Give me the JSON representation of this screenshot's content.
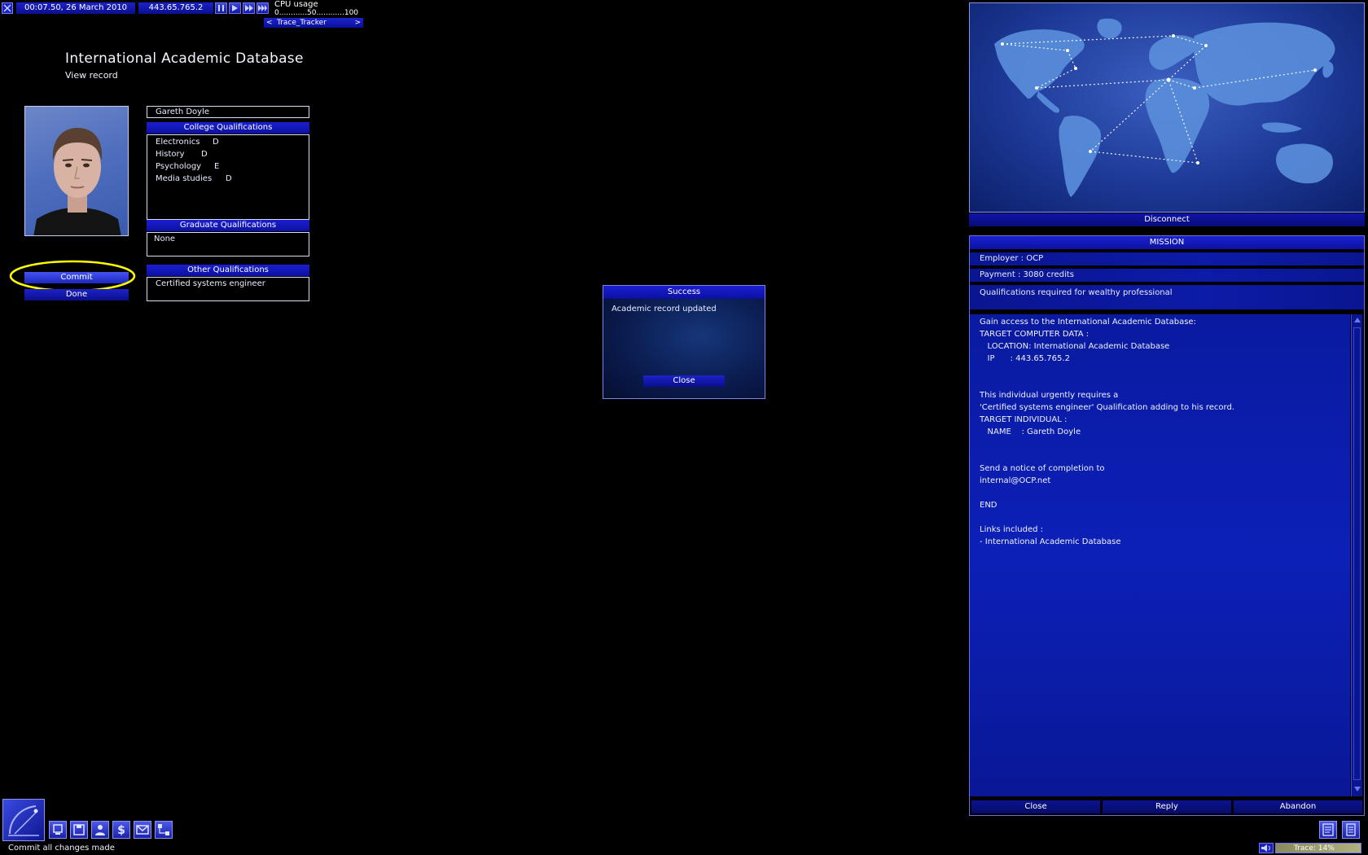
{
  "topbar": {
    "time": "00:07.50, 26 March 2010",
    "ip": "443.65.765.2",
    "cpu_label": "CPU usage",
    "cpu_scale": "0............50............100",
    "trace_tracker": "Trace_Tracker",
    "trace_prev": "<",
    "trace_next": ">"
  },
  "page": {
    "title": "International Academic Database",
    "subtitle": "View record"
  },
  "record": {
    "name": "Gareth Doyle",
    "college_header": "College Qualifications",
    "college": [
      {
        "subject": "Electronics",
        "grade": "D"
      },
      {
        "subject": "History",
        "grade": "D"
      },
      {
        "subject": "Psychology",
        "grade": "E"
      },
      {
        "subject": "Media studies",
        "grade": "D"
      }
    ],
    "graduate_header": "Graduate Qualifications",
    "graduate": "None",
    "other_header": "Other Qualifications",
    "other": "Certified systems engineer",
    "commit_label": "Commit",
    "done_label": "Done"
  },
  "dialog": {
    "title": "Success",
    "message": "Academic record updated",
    "close_label": "Close"
  },
  "map": {
    "disconnect_label": "Disconnect"
  },
  "mission": {
    "header": "MISSION",
    "employer": "Employer : OCP",
    "payment": "Payment : 3080 credits",
    "summary": "Qualifications required for wealthy professional",
    "body": [
      "Gain access to the International Academic Database:",
      "TARGET COMPUTER DATA :",
      "   LOCATION: International Academic Database",
      "   IP      : 443.65.765.2",
      "",
      "",
      "This individual urgently requires a",
      "'Certified systems engineer' Qualification adding to his record.",
      "TARGET INDIVIDUAL :",
      "   NAME    : Gareth Doyle",
      "",
      "",
      "Send a notice of completion to",
      "internal@OCP.net",
      "",
      "END",
      "",
      "Links included :",
      "- International Academic Database"
    ],
    "close_label": "Close",
    "reply_label": "Reply",
    "abandon_label": "Abandon"
  },
  "status": {
    "message": "Commit all changes made",
    "trace": "Trace: 14%"
  },
  "colors": {
    "accent": "#1a1fd0",
    "highlight": "#ffff00",
    "background": "#000000"
  }
}
